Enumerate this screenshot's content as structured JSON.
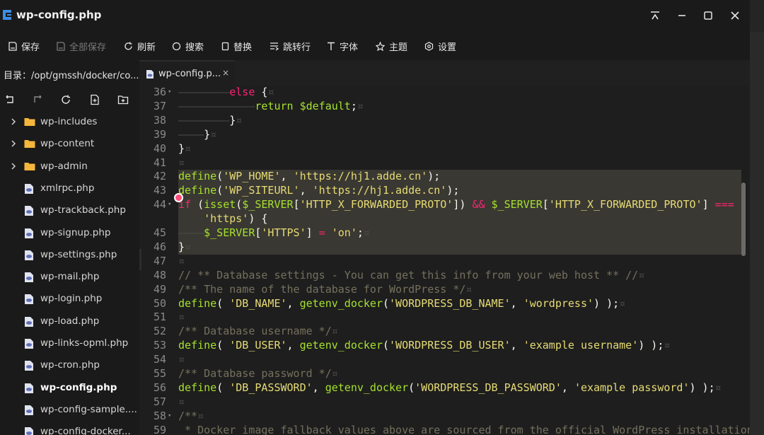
{
  "window": {
    "title": "wp-config.php",
    "controls": [
      "pin-icon",
      "minimize-icon",
      "maximize-icon",
      "close-icon"
    ]
  },
  "toolbar": {
    "save": "保存",
    "save_all": "全部保存",
    "refresh": "刷新",
    "search": "搜索",
    "replace": "替换",
    "goto_line": "跳转行",
    "font": "字体",
    "theme": "主题",
    "settings": "设置"
  },
  "sidebar": {
    "path_label": "目录：/opt/gmssh/docker/co...",
    "actions": [
      "back-icon",
      "forward-icon",
      "refresh-icon",
      "new-file-icon",
      "new-folder-icon"
    ],
    "items": [
      {
        "label": "wp-includes",
        "type": "folder"
      },
      {
        "label": "wp-content",
        "type": "folder"
      },
      {
        "label": "wp-admin",
        "type": "folder"
      },
      {
        "label": "xmlrpc.php",
        "type": "file"
      },
      {
        "label": "wp-trackback.php",
        "type": "file"
      },
      {
        "label": "wp-signup.php",
        "type": "file"
      },
      {
        "label": "wp-settings.php",
        "type": "file"
      },
      {
        "label": "wp-mail.php",
        "type": "file"
      },
      {
        "label": "wp-login.php",
        "type": "file"
      },
      {
        "label": "wp-load.php",
        "type": "file"
      },
      {
        "label": "wp-links-opml.php",
        "type": "file"
      },
      {
        "label": "wp-cron.php",
        "type": "file"
      },
      {
        "label": "wp-config.php",
        "type": "file",
        "active": true
      },
      {
        "label": "wp-config-sample....",
        "type": "file"
      },
      {
        "label": "wp-config-docker...",
        "type": "file"
      }
    ]
  },
  "tabs": [
    {
      "label": "wp-config.p...",
      "close": "×"
    }
  ],
  "editor": {
    "colors": {
      "keyword": "#f92672",
      "function": "#a6e22e",
      "string": "#e6db74",
      "comment": "#75715e",
      "plain": "#f8f8f2"
    },
    "lines": [
      {
        "n": "36",
        "fold": true,
        "t": [
          [
            "ws",
            "————————"
          ],
          [
            "kw",
            "else"
          ],
          [
            "pl",
            " {"
          ],
          [
            "ws",
            "¤"
          ]
        ]
      },
      {
        "n": "37",
        "t": [
          [
            "ws",
            "————————————"
          ],
          [
            "fn",
            "return"
          ],
          [
            "pl",
            " "
          ],
          [
            "var",
            "$default"
          ],
          [
            "pl",
            ";"
          ],
          [
            "ws",
            "¤"
          ]
        ]
      },
      {
        "n": "38",
        "t": [
          [
            "ws",
            "————————"
          ],
          [
            "pl",
            "}"
          ],
          [
            "ws",
            "¤"
          ]
        ]
      },
      {
        "n": "39",
        "t": [
          [
            "ws",
            "————"
          ],
          [
            "pl",
            "}"
          ],
          [
            "ws",
            "¤"
          ]
        ]
      },
      {
        "n": "40",
        "t": [
          [
            "pl",
            "}"
          ],
          [
            "ws",
            "¤"
          ]
        ]
      },
      {
        "n": "41",
        "t": [
          [
            "ws",
            "¤"
          ]
        ]
      },
      {
        "n": "42",
        "t": [
          [
            "fn",
            "define"
          ],
          [
            "pl",
            "("
          ],
          [
            "str",
            "'WP_HOME'"
          ],
          [
            "pl",
            ", "
          ],
          [
            "str",
            "'https://hj1.adde.cn'"
          ],
          [
            "pl",
            ");"
          ]
        ]
      },
      {
        "n": "43",
        "t": [
          [
            "fn",
            "define"
          ],
          [
            "pl",
            "("
          ],
          [
            "str",
            "'WP_SITEURL'"
          ],
          [
            "pl",
            ", "
          ],
          [
            "str",
            "'https://hj1.adde.cn'"
          ],
          [
            "pl",
            ");"
          ]
        ]
      },
      {
        "n": "44",
        "fold": true,
        "t": [
          [
            "kw",
            "if"
          ],
          [
            "pl",
            " ("
          ],
          [
            "fn",
            "isset"
          ],
          [
            "pl",
            "("
          ],
          [
            "var",
            "$_SERVER"
          ],
          [
            "pl",
            "["
          ],
          [
            "str",
            "'HTTP_X_FORWARDED_PROTO'"
          ],
          [
            "pl",
            "]) "
          ],
          [
            "op",
            "&&"
          ],
          [
            "pl",
            " "
          ],
          [
            "var",
            "$_SERVER"
          ],
          [
            "pl",
            "["
          ],
          [
            "str",
            "'HTTP_X_FORWARDED_PROTO'"
          ],
          [
            "pl",
            "] "
          ],
          [
            "op",
            "==="
          ]
        ]
      },
      {
        "n": "",
        "t": [
          [
            "pl",
            "    "
          ],
          [
            "str",
            "'https'"
          ],
          [
            "pl",
            ") {"
          ]
        ]
      },
      {
        "n": "45",
        "t": [
          [
            "ws",
            "————"
          ],
          [
            "var",
            "$_SERVER"
          ],
          [
            "pl",
            "["
          ],
          [
            "str",
            "'HTTPS'"
          ],
          [
            "pl",
            "] "
          ],
          [
            "op",
            "="
          ],
          [
            "pl",
            " "
          ],
          [
            "str",
            "'on'"
          ],
          [
            "pl",
            ";"
          ],
          [
            "ws",
            "¤"
          ]
        ]
      },
      {
        "n": "46",
        "t": [
          [
            "pl",
            "}"
          ],
          [
            "ws",
            "¤"
          ]
        ]
      },
      {
        "n": "47",
        "t": [
          [
            "ws",
            "¤"
          ]
        ]
      },
      {
        "n": "48",
        "t": [
          [
            "cm",
            "// ** Database settings - You can get this info from your web host ** //"
          ],
          [
            "ws",
            "¤"
          ]
        ]
      },
      {
        "n": "49",
        "t": [
          [
            "cm",
            "/** The name of the database for WordPress */"
          ],
          [
            "ws",
            "¤"
          ]
        ]
      },
      {
        "n": "50",
        "t": [
          [
            "fn",
            "define"
          ],
          [
            "pl",
            "( "
          ],
          [
            "str",
            "'DB_NAME'"
          ],
          [
            "pl",
            ", "
          ],
          [
            "fn",
            "getenv_docker"
          ],
          [
            "pl",
            "("
          ],
          [
            "str",
            "'WORDPRESS_DB_NAME'"
          ],
          [
            "pl",
            ", "
          ],
          [
            "str",
            "'wordpress'"
          ],
          [
            "pl",
            ") );"
          ],
          [
            "ws",
            "¤"
          ]
        ]
      },
      {
        "n": "51",
        "t": [
          [
            "ws",
            "¤"
          ]
        ]
      },
      {
        "n": "52",
        "t": [
          [
            "cm",
            "/** Database username */"
          ],
          [
            "ws",
            "¤"
          ]
        ]
      },
      {
        "n": "53",
        "t": [
          [
            "fn",
            "define"
          ],
          [
            "pl",
            "( "
          ],
          [
            "str",
            "'DB_USER'"
          ],
          [
            "pl",
            ", "
          ],
          [
            "fn",
            "getenv_docker"
          ],
          [
            "pl",
            "("
          ],
          [
            "str",
            "'WORDPRESS_DB_USER'"
          ],
          [
            "pl",
            ", "
          ],
          [
            "str",
            "'example username'"
          ],
          [
            "pl",
            ") );"
          ],
          [
            "ws",
            "¤"
          ]
        ]
      },
      {
        "n": "54",
        "t": [
          [
            "ws",
            "¤"
          ]
        ]
      },
      {
        "n": "55",
        "t": [
          [
            "cm",
            "/** Database password */"
          ],
          [
            "ws",
            "¤"
          ]
        ]
      },
      {
        "n": "56",
        "t": [
          [
            "fn",
            "define"
          ],
          [
            "pl",
            "( "
          ],
          [
            "str",
            "'DB_PASSWORD'"
          ],
          [
            "pl",
            ", "
          ],
          [
            "fn",
            "getenv_docker"
          ],
          [
            "pl",
            "("
          ],
          [
            "str",
            "'WORDPRESS_DB_PASSWORD'"
          ],
          [
            "pl",
            ", "
          ],
          [
            "str",
            "'example password'"
          ],
          [
            "pl",
            ") );"
          ],
          [
            "ws",
            "¤"
          ]
        ]
      },
      {
        "n": "57",
        "t": [
          [
            "ws",
            "¤"
          ]
        ]
      },
      {
        "n": "58",
        "fold": true,
        "t": [
          [
            "cm",
            "/**"
          ],
          [
            "ws",
            "¤"
          ]
        ]
      },
      {
        "n": "59",
        "t": [
          [
            "cm",
            " * Docker image fallback values above are sourced from the official WordPress installation"
          ]
        ]
      }
    ]
  }
}
